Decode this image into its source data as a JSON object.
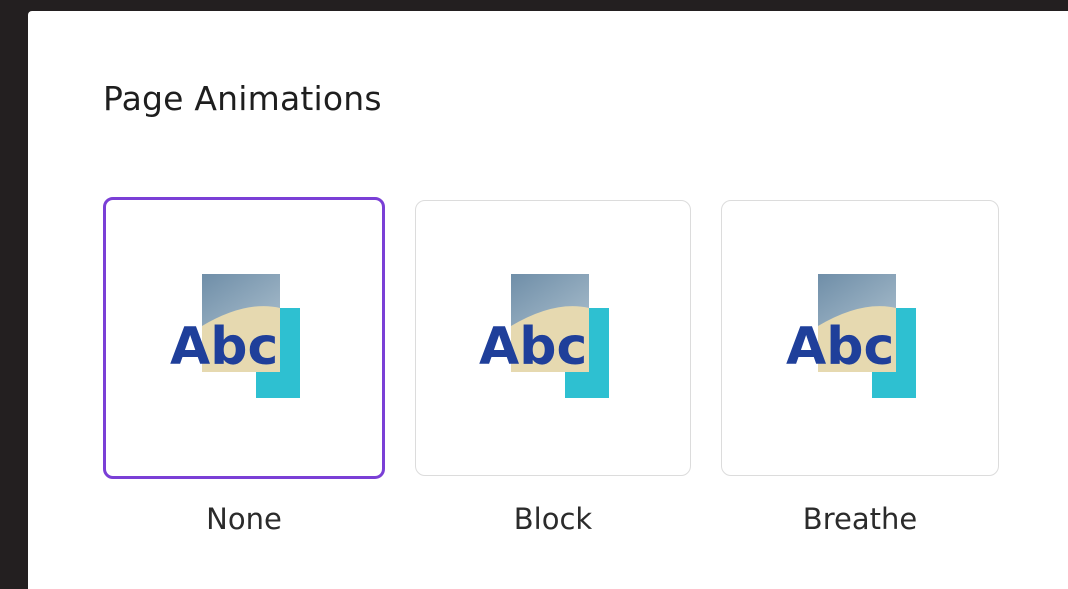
{
  "panel": {
    "title": "Page Animations"
  },
  "animations": [
    {
      "label": "None",
      "selected": true,
      "thumbnail_text": "Abc"
    },
    {
      "label": "Block",
      "selected": false,
      "thumbnail_text": "Abc"
    },
    {
      "label": "Breathe",
      "selected": false,
      "thumbnail_text": "Abc"
    }
  ],
  "colors": {
    "background": "#231f20",
    "panel": "#ffffff",
    "selected_border": "#7a3fd6",
    "tile_border": "#dcdcdc",
    "thumbnail_text": "#1f3f9a",
    "thumbnail_teal": "#2ec0d1"
  }
}
